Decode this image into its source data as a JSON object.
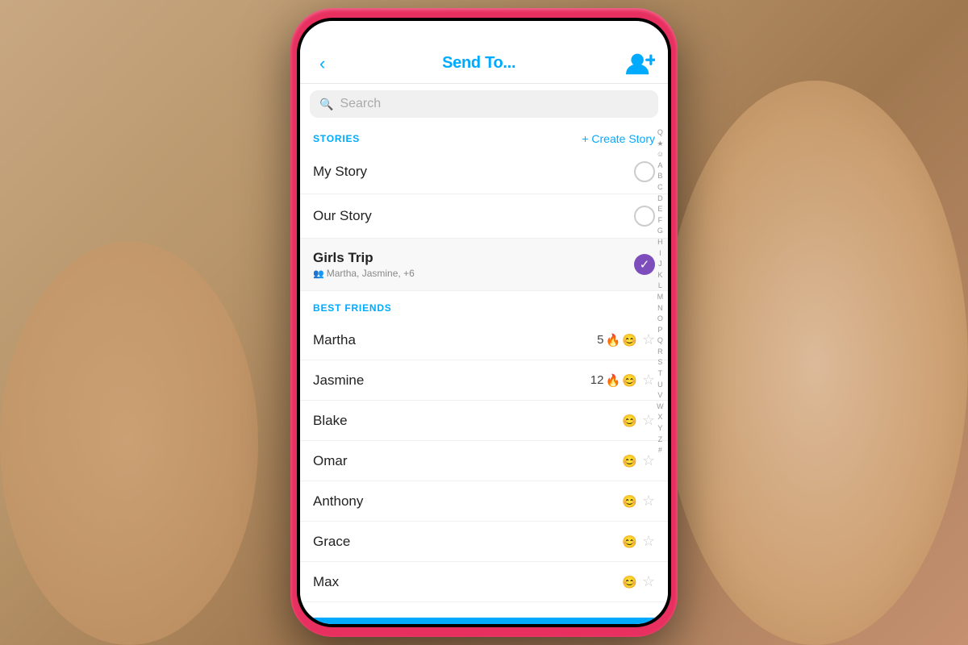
{
  "background": {
    "color": "#c4956a"
  },
  "header": {
    "back_label": "‹",
    "title": "Send To...",
    "add_friend_label": "+"
  },
  "search": {
    "placeholder": "Search"
  },
  "stories_section": {
    "label": "STORIES",
    "create_story_label": "+ Create Story",
    "items": [
      {
        "name": "My Story",
        "checked": false
      },
      {
        "name": "Our Story",
        "checked": false
      },
      {
        "name": "Girls Trip",
        "checked": true,
        "subtitle": "Martha, Jasmine, +6",
        "bold": true
      }
    ]
  },
  "best_friends_section": {
    "label": "BEST FRIENDS",
    "items": [
      {
        "name": "Martha",
        "streak": "5",
        "fire": true,
        "smile": true,
        "star": false
      },
      {
        "name": "Jasmine",
        "streak": "12",
        "fire": true,
        "smile": true,
        "star": false
      },
      {
        "name": "Blake",
        "streak": "",
        "fire": false,
        "smile": true,
        "star": false
      },
      {
        "name": "Omar",
        "streak": "",
        "fire": false,
        "smile": true,
        "star": false
      },
      {
        "name": "Anthony",
        "streak": "",
        "fire": false,
        "smile": true,
        "star": false
      },
      {
        "name": "Grace",
        "streak": "",
        "fire": false,
        "smile": true,
        "star": false
      },
      {
        "name": "Max",
        "streak": "",
        "fire": false,
        "smile": true,
        "star": false
      }
    ]
  },
  "alpha_index": [
    "Q",
    "★",
    "☺",
    "A",
    "B",
    "C",
    "D",
    "E",
    "F",
    "G",
    "H",
    "I",
    "J",
    "K",
    "L",
    "M",
    "N",
    "O",
    "P",
    "Q",
    "R",
    "S",
    "T",
    "U",
    "V",
    "W",
    "X",
    "Y",
    "Z",
    "#"
  ]
}
